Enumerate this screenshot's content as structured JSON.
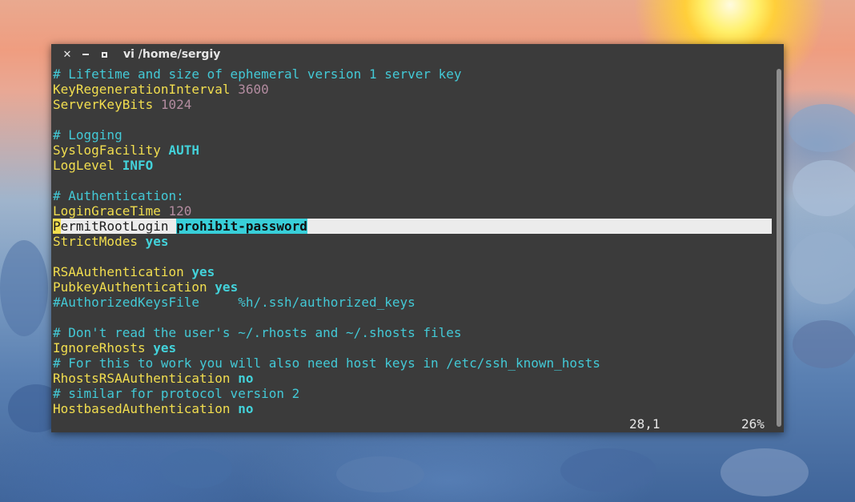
{
  "window": {
    "title": "vi /home/sergiy",
    "buttons": {
      "close": "✕",
      "minimize": "–",
      "maximize": "□"
    }
  },
  "lines": [
    {
      "parts": [
        {
          "t": "# Lifetime and size of ephemeral version 1 server key",
          "c": "c"
        }
      ]
    },
    {
      "parts": [
        {
          "t": "KeyRegenerationInterval",
          "c": "k"
        },
        {
          "t": " ",
          "c": ""
        },
        {
          "t": "3600",
          "c": "n"
        }
      ]
    },
    {
      "parts": [
        {
          "t": "ServerKeyBits",
          "c": "k"
        },
        {
          "t": " ",
          "c": ""
        },
        {
          "t": "1024",
          "c": "n"
        }
      ]
    },
    {
      "parts": []
    },
    {
      "parts": [
        {
          "t": "# Logging",
          "c": "c"
        }
      ]
    },
    {
      "parts": [
        {
          "t": "SyslogFacility",
          "c": "k"
        },
        {
          "t": " ",
          "c": ""
        },
        {
          "t": "AUTH",
          "c": "v"
        }
      ]
    },
    {
      "parts": [
        {
          "t": "LogLevel",
          "c": "k"
        },
        {
          "t": " ",
          "c": ""
        },
        {
          "t": "INFO",
          "c": "v"
        }
      ]
    },
    {
      "parts": []
    },
    {
      "parts": [
        {
          "t": "# Authentication:",
          "c": "c"
        }
      ]
    },
    {
      "parts": [
        {
          "t": "LoginGraceTime",
          "c": "k"
        },
        {
          "t": " ",
          "c": ""
        },
        {
          "t": "120",
          "c": "n"
        }
      ]
    },
    {
      "cursorline": true,
      "parts": [
        {
          "t": "P",
          "c": "cursor"
        },
        {
          "t": "ermitRootLogin",
          "c": "k"
        },
        {
          "t": " ",
          "c": ""
        },
        {
          "t": "prohibit-password",
          "c": "match"
        }
      ]
    },
    {
      "parts": [
        {
          "t": "StrictModes",
          "c": "k"
        },
        {
          "t": " ",
          "c": ""
        },
        {
          "t": "yes",
          "c": "v"
        }
      ]
    },
    {
      "parts": []
    },
    {
      "parts": [
        {
          "t": "RSAAuthentication",
          "c": "k"
        },
        {
          "t": " ",
          "c": ""
        },
        {
          "t": "yes",
          "c": "v"
        }
      ]
    },
    {
      "parts": [
        {
          "t": "PubkeyAuthentication",
          "c": "k"
        },
        {
          "t": " ",
          "c": ""
        },
        {
          "t": "yes",
          "c": "v"
        }
      ]
    },
    {
      "parts": [
        {
          "t": "#AuthorizedKeysFile     %h/.ssh/authorized_keys",
          "c": "p"
        }
      ]
    },
    {
      "parts": []
    },
    {
      "parts": [
        {
          "t": "# Don't read the user's ~/.rhosts and ~/.shosts files",
          "c": "c"
        }
      ]
    },
    {
      "parts": [
        {
          "t": "IgnoreRhosts",
          "c": "k"
        },
        {
          "t": " ",
          "c": ""
        },
        {
          "t": "yes",
          "c": "v"
        }
      ]
    },
    {
      "parts": [
        {
          "t": "# For this to work you will also need host keys in /etc/ssh_known_hosts",
          "c": "c"
        }
      ]
    },
    {
      "parts": [
        {
          "t": "RhostsRSAAuthentication",
          "c": "k"
        },
        {
          "t": " ",
          "c": ""
        },
        {
          "t": "no",
          "c": "v"
        }
      ]
    },
    {
      "parts": [
        {
          "t": "# similar for protocol version 2",
          "c": "c"
        }
      ]
    },
    {
      "parts": [
        {
          "t": "HostbasedAuthentication",
          "c": "k"
        },
        {
          "t": " ",
          "c": ""
        },
        {
          "t": "no",
          "c": "v"
        }
      ]
    }
  ],
  "status": {
    "position": "28,1",
    "percent": "26%"
  },
  "scroll": {
    "fraction_visible": 0.99
  },
  "colors": {
    "keyword": "#f2de4f",
    "comment": "#43c9d6",
    "number": "#b38ca0",
    "value": "#43d2da",
    "background": "#3b3b3b",
    "cursorline": "#ececec"
  }
}
